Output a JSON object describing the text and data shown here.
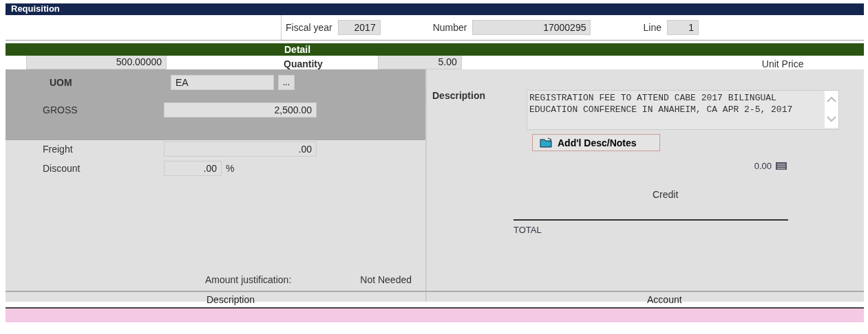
{
  "window": {
    "title": "Requisition"
  },
  "header": {
    "fields": [
      {
        "label": "Fiscal year",
        "value": "2017"
      },
      {
        "label": "Number",
        "value": "17000295"
      },
      {
        "label": "Line",
        "value": "1"
      }
    ]
  },
  "detail": {
    "title": "Detail",
    "top_row": {
      "field_1": "500.00000",
      "quantity_label": "Quantity",
      "quantity": "5.00",
      "unit_price_label": "Unit Price"
    },
    "uom": {
      "label": "UOM",
      "value": "EA",
      "lookup": "..."
    },
    "gross": {
      "label": "GROSS",
      "value": "2,500.00"
    },
    "amounts": [
      {
        "label": "Freight",
        "value": ".00"
      },
      {
        "label": "Discount",
        "value": ".00",
        "unit": "%"
      }
    ],
    "description": {
      "label": "Description",
      "value": "REGISTRATION FEE TO ATTEND CABE 2017 BILINGUAL EDUCATION CONFERENCE IN ANAHEIM, CA APR 2-5, 2017"
    },
    "notes_button": "Add'l Desc/Notes",
    "tax_value": "0.00",
    "credit_label": "Credit",
    "total_label": "TOTAL",
    "justification": {
      "label": "Amount justification:",
      "value": "Not Needed"
    }
  },
  "table": {
    "columns": [
      "Description",
      "Account"
    ],
    "rows": [
      {
        "selected": true
      }
    ]
  }
}
